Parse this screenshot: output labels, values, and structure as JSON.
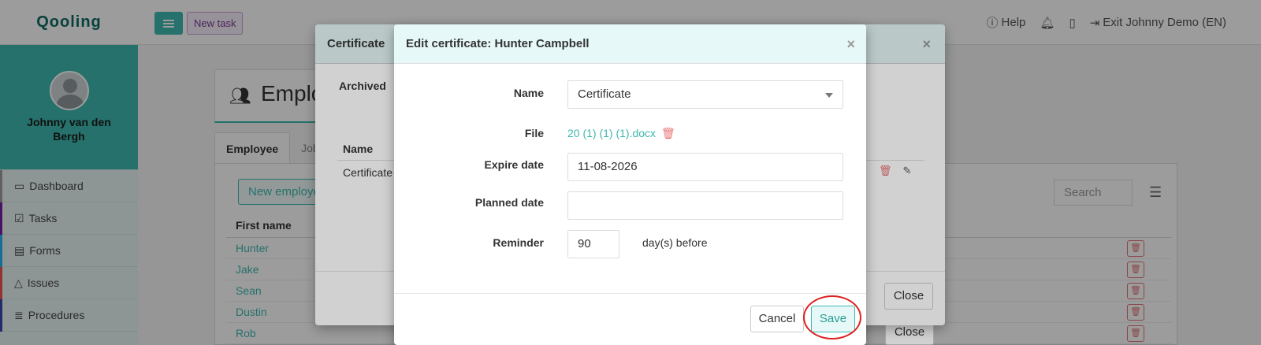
{
  "app": {
    "logo": "Qooling"
  },
  "topbar": {
    "new_task": "New task",
    "help": "Help",
    "exit": "Exit Johnny Demo (EN)"
  },
  "sidebar": {
    "user_name": "Johnny van den Bergh",
    "items": [
      {
        "label": "Dashboard",
        "icon": "monitor-icon",
        "color": "#9e9e9e"
      },
      {
        "label": "Tasks",
        "icon": "checkbox-icon",
        "color": "#7b1fa2"
      },
      {
        "label": "Forms",
        "icon": "document-icon",
        "color": "#29b6f6"
      },
      {
        "label": "Issues",
        "icon": "bell-icon",
        "color": "#ef5350"
      },
      {
        "label": "Procedures",
        "icon": "list-icon",
        "color": "#3949ab"
      }
    ]
  },
  "page": {
    "title": "Employ",
    "tabs": [
      "Employee",
      "Job"
    ],
    "new_employee": "New employe",
    "search_placeholder": "Search",
    "table": {
      "header": "First name",
      "rows": [
        "Hunter",
        "Jake",
        "Sean",
        "Dustin",
        "Rob"
      ]
    },
    "close_under": "Close"
  },
  "certificate_modal": {
    "title": "Certificate",
    "archived": "Archived",
    "col_name": "Name",
    "row_name": "Certificate",
    "close": "Close"
  },
  "edit_modal": {
    "title": "Edit certificate: Hunter Campbell",
    "labels": {
      "name": "Name",
      "file": "File",
      "expire": "Expire date",
      "planned": "Planned date",
      "reminder": "Reminder"
    },
    "values": {
      "name": "Certificate",
      "file": "20 (1) (1) (1).docx",
      "expire": "11-08-2026",
      "planned": "",
      "reminder": "90",
      "reminder_suffix": "day(s) before"
    },
    "cancel": "Cancel",
    "save": "Save"
  },
  "colors": {
    "accent": "#3fb8af",
    "danger": "#e57373",
    "highlight": "#e02020"
  }
}
